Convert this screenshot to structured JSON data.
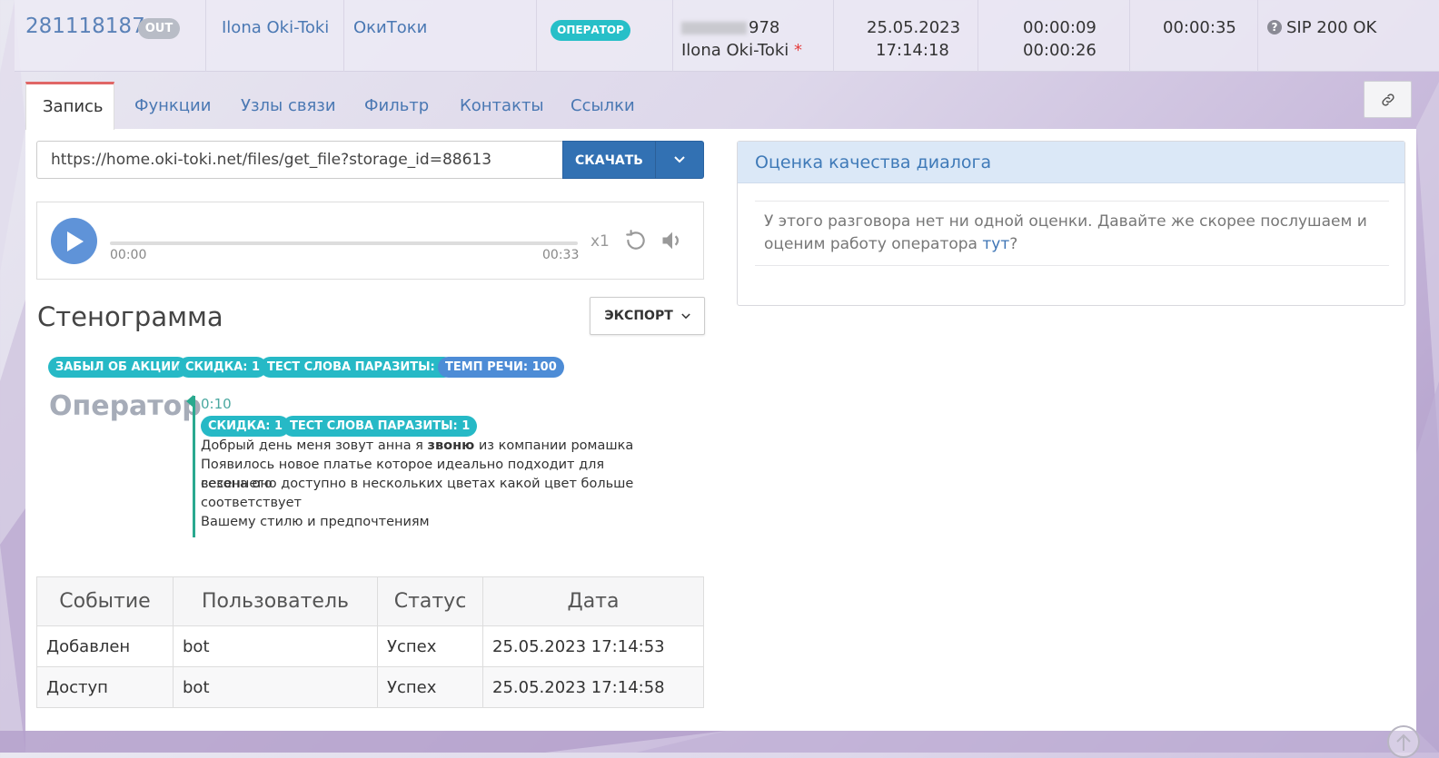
{
  "call": {
    "id": "281118187",
    "direction": "OUT",
    "user_name": "Ilona Oki-Toki",
    "project": "ОкиТоки",
    "role": "ОПЕРАТОР",
    "phone_suffix": "978",
    "agent_name": "Ilona Oki-Toki",
    "required_mark": "*",
    "date": "25.05.2023",
    "time": "17:14:18",
    "wait": "00:00:09",
    "talk": "00:00:26",
    "duration": "00:00:35",
    "result": "SIP 200 OK",
    "result_icon": "?"
  },
  "tabs": [
    "Запись",
    "Функции",
    "Узлы связи",
    "Фильтр",
    "Контакты",
    "Ссылки"
  ],
  "recording": {
    "url": "https://home.oki-toki.net/files/get_file?storage_id=88613",
    "download_label": "СКАЧАТЬ",
    "time_start": "00:00",
    "time_end": "00:33",
    "speed": "x1",
    "progress": 0
  },
  "transcript": {
    "title": "Стенограмма",
    "export_label": "ЭКСПОРТ",
    "tags": [
      "ЗАБЫЛ ОБ АКЦИИ",
      "СКИДКА: 1",
      "ТЕСТ СЛОВА ПАРАЗИТЫ: 1",
      "ТЕМП РЕЧИ: 100"
    ],
    "message": {
      "speaker": "Оператор",
      "time": "0:10",
      "tags": [
        "СКИДКА: 1",
        "ТЕСТ СЛОВА ПАРАЗИТЫ: 1"
      ],
      "line1_before": "Добрый день меня зовут анна я ",
      "line1_bold": "звоню",
      "line1_after": " из компании ромашка",
      "line2": "Появилось новое платье которое идеально подходит для весеннего",
      "line3": "сезона оно доступно в нескольких цветах какой цвет больше",
      "line4": "соответствует",
      "line5": "Вашему стилю и предпочтениям"
    }
  },
  "events": {
    "headers": [
      "Событие",
      "Пользователь",
      "Статус",
      "Дата"
    ],
    "rows": [
      [
        "Добавлен",
        "bot",
        "Успех",
        "25.05.2023 17:14:53"
      ],
      [
        "Доступ",
        "bot",
        "Успех",
        "25.05.2023 17:14:58"
      ]
    ]
  },
  "quality": {
    "title": "Оценка качества диалога",
    "text_before": "У этого разговора нет ни одной оценки. Давайте же скорее послушаем и оценим работу оператора ",
    "link": "тут",
    "text_after": "?"
  },
  "colors": {
    "accent": "#3271b3",
    "tag": "#26b9c6",
    "tag_blue": "#4d8cd6",
    "active_tab_border": "#e06666"
  }
}
